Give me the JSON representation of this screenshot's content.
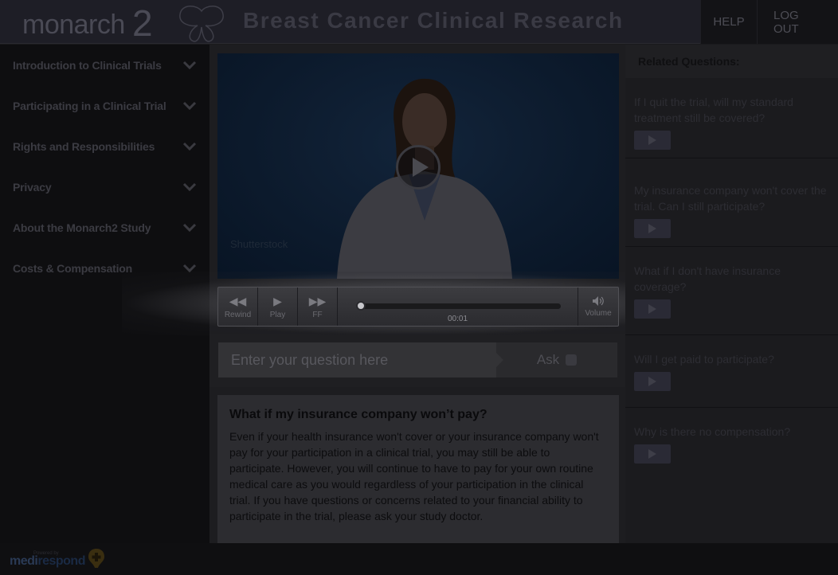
{
  "header": {
    "logo_text": "monarch",
    "logo_number": "2",
    "title": "Breast Cancer Clinical Research",
    "nav": {
      "help": "HELP",
      "logout": "LOG OUT"
    }
  },
  "sidebar": {
    "items": [
      {
        "label": "Introduction to Clinical Trials"
      },
      {
        "label": "Participating in a Clinical Trial"
      },
      {
        "label": "Rights and Responsibilities"
      },
      {
        "label": "Privacy"
      },
      {
        "label": "About the Monarch2 Study"
      },
      {
        "label": "Costs & Compensation"
      }
    ]
  },
  "video": {
    "watermark": "Shutterstock",
    "controls": {
      "rewind": "Rewind",
      "play": "Play",
      "ff": "FF",
      "time": "00:01",
      "volume": "Volume"
    }
  },
  "ask": {
    "placeholder": "Enter your question here",
    "button": "Ask"
  },
  "answer": {
    "title": "What if my insurance company won’t pay?",
    "body": "Even if your health insurance won't cover or your insurance company won't pay for your participation in a clinical trial, you may still be able to participate. However, you will continue to have to pay for your own routine medical care as you would regardless of your participation in the clinical trial. If you have questions or concerns related to your financial ability to participate in the trial, please ask your study doctor."
  },
  "related": {
    "title": "Related Questions:",
    "items": [
      {
        "question": "If I quit the trial, will my standard treatment still be covered?"
      },
      {
        "question": "My insurance company won't cover the trial. Can I still participate?"
      },
      {
        "question": "What if I don't have insurance coverage?"
      },
      {
        "question": "Will I get paid to participate?"
      },
      {
        "question": "Why is there no compensation?"
      }
    ]
  },
  "footer": {
    "powered_by": "Powered by",
    "brand_a": "medi",
    "brand_b": "respond"
  },
  "colors": {
    "background": "#1a1a1c",
    "sidebar": "#0e0e10",
    "accent_play": "#2a2a35"
  }
}
